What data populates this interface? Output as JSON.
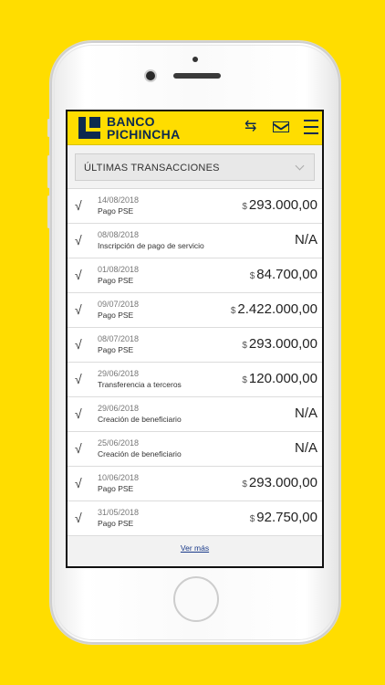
{
  "header": {
    "brand_line1": "BANCO",
    "brand_line2": "PICHINCHA",
    "swap_icon": "⇆",
    "mail_icon": "envelope-icon",
    "menu_icon": "hamburger-icon"
  },
  "filter": {
    "label": "ÚLTIMAS TRANSACCIONES"
  },
  "transactions": [
    {
      "date": "14/08/2018",
      "desc": "Pago PSE",
      "currency": "$",
      "amount": "293.000,00"
    },
    {
      "date": "08/08/2018",
      "desc": "Inscripción de pago de servicio",
      "currency": "",
      "amount": "N/A"
    },
    {
      "date": "01/08/2018",
      "desc": "Pago PSE",
      "currency": "$",
      "amount": "84.700,00"
    },
    {
      "date": "09/07/2018",
      "desc": "Pago PSE",
      "currency": "$",
      "amount": "2.422.000,00"
    },
    {
      "date": "08/07/2018",
      "desc": "Pago PSE",
      "currency": "$",
      "amount": "293.000,00"
    },
    {
      "date": "29/06/2018",
      "desc": "Transferencia a terceros",
      "currency": "$",
      "amount": "120.000,00"
    },
    {
      "date": "29/06/2018",
      "desc": "Creación de beneficiario",
      "currency": "",
      "amount": "N/A"
    },
    {
      "date": "25/06/2018",
      "desc": "Creación de beneficiario",
      "currency": "",
      "amount": "N/A"
    },
    {
      "date": "10/06/2018",
      "desc": "Pago PSE",
      "currency": "$",
      "amount": "293.000,00"
    },
    {
      "date": "31/05/2018",
      "desc": "Pago PSE",
      "currency": "$",
      "amount": "92.750,00"
    }
  ],
  "check_glyph": "√",
  "more_link": "Ver más",
  "colors": {
    "background": "#FFDD00",
    "brand_navy": "#0c2a4f"
  }
}
